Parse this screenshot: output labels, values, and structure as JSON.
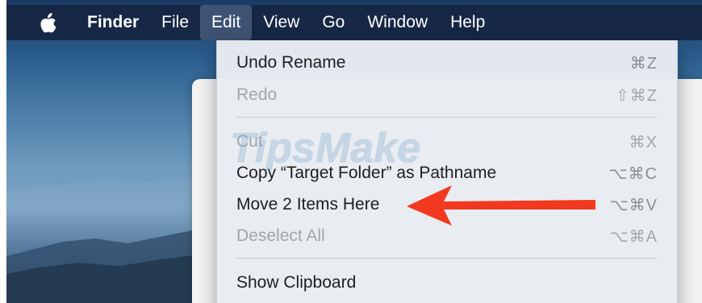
{
  "menubar": {
    "apple_icon": "apple-logo-icon",
    "app_name": "Finder",
    "items": [
      "File",
      "Edit",
      "View",
      "Go",
      "Window",
      "Help"
    ],
    "active_item": "Edit"
  },
  "edit_menu": {
    "items": [
      {
        "label": "Undo Rename",
        "shortcut": "⌘Z",
        "enabled": true
      },
      {
        "label": "Redo",
        "shortcut": "⇧⌘Z",
        "enabled": false
      },
      {
        "label": "Cut",
        "shortcut": "⌘X",
        "enabled": false
      },
      {
        "label": "Copy “Target Folder” as Pathname",
        "shortcut": "⌥⌘C",
        "enabled": true
      },
      {
        "label": "Move 2 Items Here",
        "shortcut": "⌥⌘V",
        "enabled": true
      },
      {
        "label": "Deselect All",
        "shortcut": "⌥⌘A",
        "enabled": false
      },
      {
        "label": "Show Clipboard",
        "shortcut": "",
        "enabled": true
      }
    ]
  },
  "watermark": {
    "text": "TipsMake"
  },
  "annotation": {
    "icon": "red-arrow-icon",
    "color": "#f2391f"
  }
}
